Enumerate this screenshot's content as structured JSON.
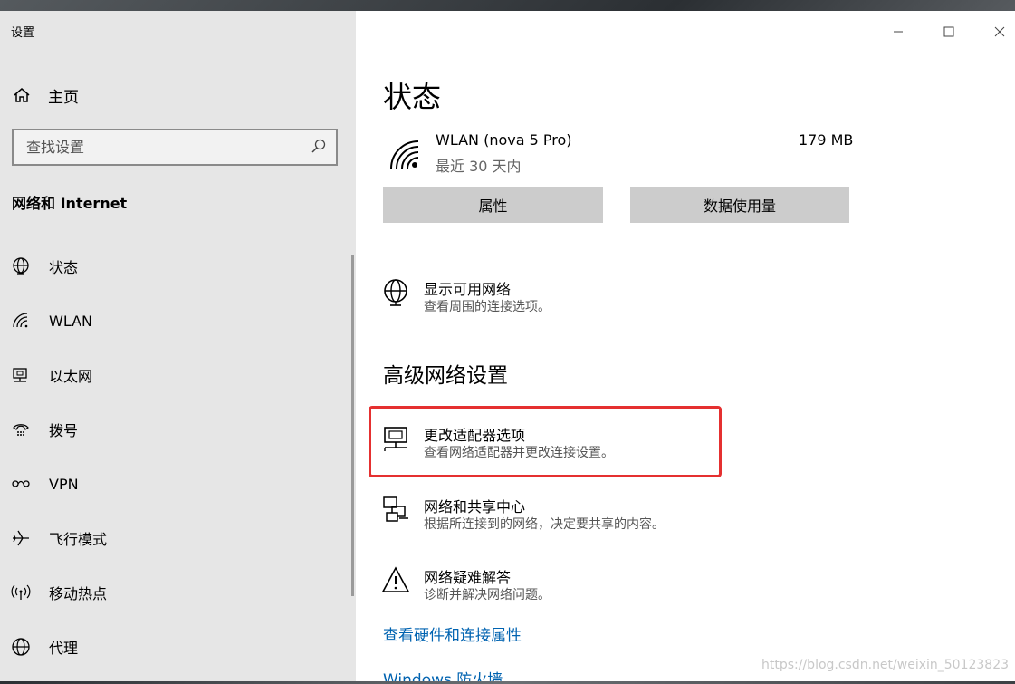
{
  "window": {
    "title": "设置"
  },
  "sidebar": {
    "home_label": "主页",
    "search_placeholder": "查找设置",
    "section_title": "网络和 Internet",
    "items": [
      {
        "label": "状态",
        "icon": "globe-status-icon"
      },
      {
        "label": "WLAN",
        "icon": "wifi-icon"
      },
      {
        "label": "以太网",
        "icon": "ethernet-icon"
      },
      {
        "label": "拨号",
        "icon": "dialup-icon"
      },
      {
        "label": "VPN",
        "icon": "vpn-icon"
      },
      {
        "label": "飞行模式",
        "icon": "airplane-icon"
      },
      {
        "label": "移动热点",
        "icon": "hotspot-icon"
      },
      {
        "label": "代理",
        "icon": "proxy-globe-icon"
      }
    ]
  },
  "main": {
    "title": "状态",
    "connection": {
      "name": "WLAN (nova 5 Pro)",
      "period": "最近 30 天内",
      "usage": "179 MB"
    },
    "buttons": {
      "properties": "属性",
      "data_usage": "数据使用量"
    },
    "show_networks": {
      "title": "显示可用网络",
      "desc": "查看周围的连接选项。"
    },
    "advanced_heading": "高级网络设置",
    "advanced_items": [
      {
        "title": "更改适配器选项",
        "desc": "查看网络适配器并更改连接设置。"
      },
      {
        "title": "网络和共享中心",
        "desc": "根据所连接到的网络，决定要共享的内容。"
      },
      {
        "title": "网络疑难解答",
        "desc": "诊断并解决网络问题。"
      }
    ],
    "links": {
      "hardware": "查看硬件和连接属性",
      "firewall": "Windows 防火墙"
    },
    "watermark": "https://blog.csdn.net/weixin_50123823"
  },
  "colors": {
    "sidebar_bg": "#e6e6e6",
    "button_bg": "#cccccc",
    "link": "#0063b1",
    "highlight": "#e53030"
  }
}
